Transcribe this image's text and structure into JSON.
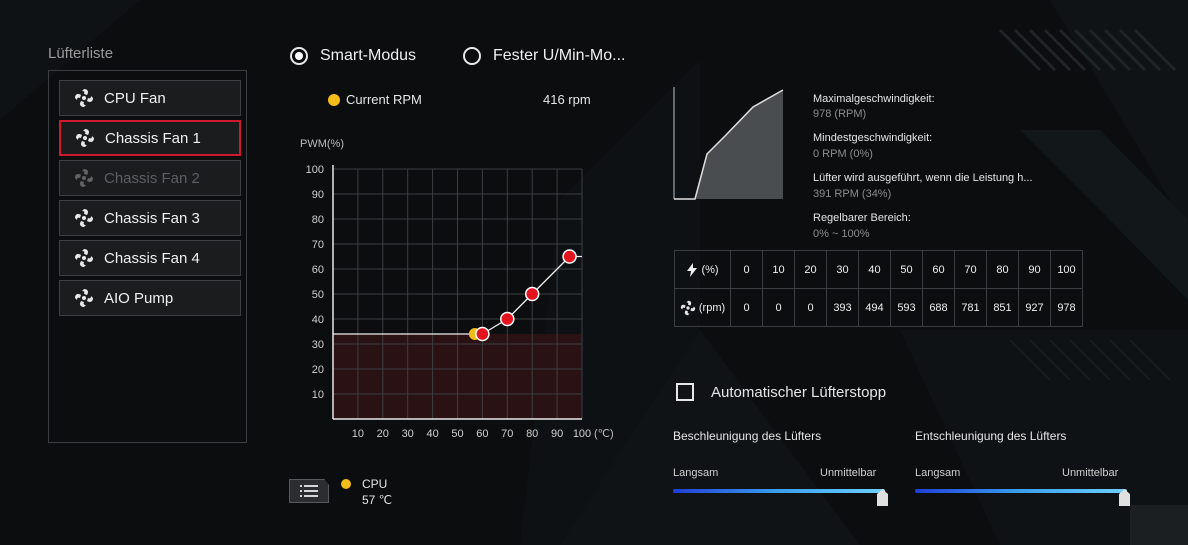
{
  "fan_list": {
    "title": "Lüfterliste",
    "items": [
      {
        "label": "CPU Fan",
        "state": "normal"
      },
      {
        "label": "Chassis Fan 1",
        "state": "selected"
      },
      {
        "label": "Chassis Fan 2",
        "state": "disabled"
      },
      {
        "label": "Chassis Fan 3",
        "state": "normal"
      },
      {
        "label": "Chassis Fan 4",
        "state": "normal"
      },
      {
        "label": "AIO Pump",
        "state": "normal"
      }
    ]
  },
  "modes": {
    "smart": "Smart-Modus",
    "fixed": "Fester U/Min-Mo...",
    "selected": "smart"
  },
  "current_rpm": {
    "label": "Current RPM",
    "value": "416 rpm"
  },
  "sensor": {
    "name": "CPU",
    "value": "57 ℃"
  },
  "chart_data": {
    "type": "line",
    "ylabel": "PWM(%)",
    "xlabel": "(℃)",
    "x_ticks": [
      10,
      20,
      30,
      40,
      50,
      60,
      70,
      80,
      90,
      100
    ],
    "y_ticks": [
      10,
      20,
      30,
      40,
      50,
      60,
      70,
      80,
      90,
      100
    ],
    "xlim": [
      0,
      100
    ],
    "ylim": [
      0,
      100
    ],
    "grid": true,
    "series": [
      {
        "x": [
          0,
          60,
          70,
          80,
          95,
          100
        ],
        "y": [
          34,
          34,
          40,
          50,
          65,
          65
        ],
        "points": [
          [
            60,
            34
          ],
          [
            70,
            40
          ],
          [
            80,
            50
          ],
          [
            95,
            65
          ]
        ]
      }
    ],
    "current_marker": {
      "x": 57,
      "y": 34
    },
    "colors": {
      "point": "#e3141e",
      "marker": "#f3bd19",
      "fill": "#2a1214"
    }
  },
  "info": {
    "max_label": "Maximalgeschwindigkeit:",
    "max_value": "978 (RPM)",
    "min_label": "Mindestgeschwindigkeit:",
    "min_value": "0 RPM (0%)",
    "run_label": "Lüfter wird ausgeführt, wenn die Leistung h...",
    "run_value": "391 RPM (34%)",
    "range_label": "Regelbarer Bereich:",
    "range_value": "0% ~ 100%"
  },
  "table": {
    "row1_header": "(%)",
    "row2_header": "(rpm)",
    "percent": [
      "0",
      "10",
      "20",
      "30",
      "40",
      "50",
      "60",
      "70",
      "80",
      "90",
      "100"
    ],
    "rpm": [
      "0",
      "0",
      "0",
      "393",
      "494",
      "593",
      "688",
      "781",
      "851",
      "927",
      "978"
    ]
  },
  "auto_stop": {
    "label": "Automatischer Lüfterstopp",
    "checked": false
  },
  "accel": {
    "title": "Beschleunigung des Lüfters",
    "low": "Langsam",
    "high": "Unmittelbar",
    "value": 1.0
  },
  "decel": {
    "title": "Entschleunigung des Lüfters",
    "low": "Langsam",
    "high": "Unmittelbar",
    "value": 1.0
  }
}
